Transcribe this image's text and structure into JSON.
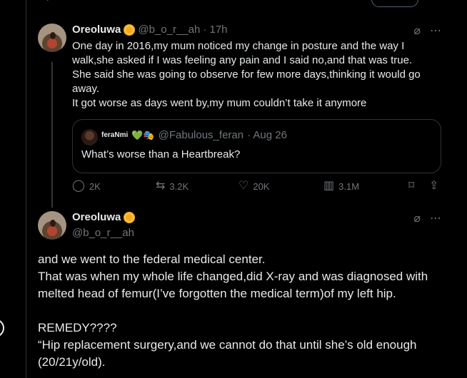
{
  "thread": {
    "post1": {
      "name": "Oreoluwa",
      "handle": "@b_o_r__ah",
      "time": "· 17h",
      "body": [
        "One day in 2016,my mum noticed my change in posture and the way I",
        "walk,she asked if I was feeling any pain and I said no,and that was true.",
        "She said she was going to observe for few more days,thinking it would go",
        "away.",
        "It got worse as days went by,my mum couldn’t take it anymore"
      ],
      "quote": {
        "name": "feraNmi",
        "handle": "@Fabulous_feran",
        "date": "· Aug 26",
        "text": "What’s worse than a Heartbreak?"
      },
      "stats": {
        "replies": "2K",
        "reposts": "3.2K",
        "likes": "20K",
        "views": "3.1M"
      }
    },
    "post2": {
      "name": "Oreoluwa",
      "handle": "@b_o_r__ah",
      "body": [
        "and we went to the federal medical center.",
        "That was when my whole life changed,did X-ray and was diagnosed with",
        "melted head of femur(I’ve forgotten the medical term)of my left hip.",
        "",
        "REMEDY????",
        "“Hip replacement surgery,and we cannot do that until she’s old enough",
        "(20/21y/old)."
      ]
    }
  },
  "icons": {
    "grok": "grok-icon",
    "more": "more-icon",
    "reply": "reply-icon",
    "repost": "repost-icon",
    "like": "like-icon",
    "views": "views-icon",
    "bookmark": "bookmark-icon",
    "share": "share-icon"
  }
}
